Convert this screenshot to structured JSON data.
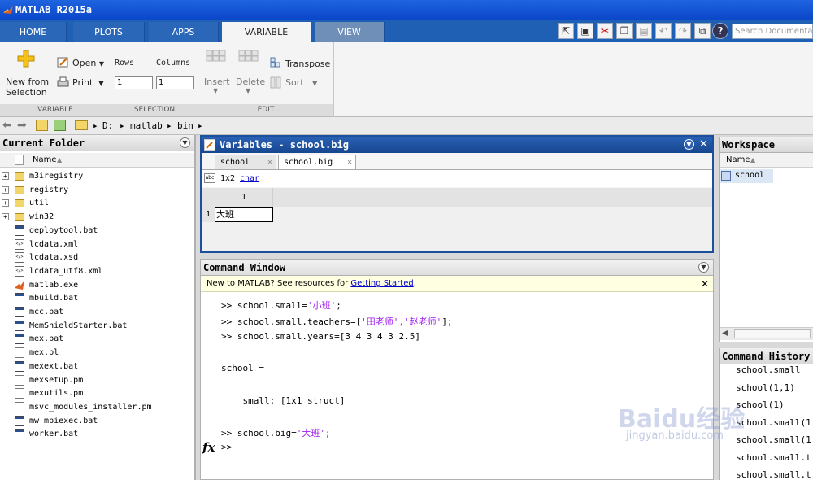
{
  "app": {
    "title": "MATLAB R2015a"
  },
  "ribbon_tabs": [
    {
      "label": "HOME"
    },
    {
      "label": "PLOTS"
    },
    {
      "label": "APPS"
    },
    {
      "label": "VARIABLE"
    },
    {
      "label": "VIEW"
    }
  ],
  "search": {
    "placeholder": "Search Documentation"
  },
  "ribbon": {
    "variable": {
      "new_from_line1": "New from",
      "new_from_line2": "Selection",
      "open": "Open",
      "print": "Print",
      "section": "VARIABLE"
    },
    "selection": {
      "rows_label": "Rows",
      "columns_label": "Columns",
      "rows_value": "1",
      "columns_value": "1",
      "section": "SELECTION"
    },
    "edit": {
      "insert": "Insert",
      "delete": "Delete",
      "transpose": "Transpose",
      "sort": "Sort",
      "section": "EDIT"
    }
  },
  "address": {
    "path": [
      "D:",
      "matlab",
      "bin"
    ]
  },
  "current_folder": {
    "title": "Current Folder",
    "column_name": "Name",
    "items": [
      {
        "name": "m3iregistry",
        "type": "folder"
      },
      {
        "name": "registry",
        "type": "folder"
      },
      {
        "name": "util",
        "type": "folder"
      },
      {
        "name": "win32",
        "type": "folder"
      },
      {
        "name": "deploytool.bat",
        "type": "bat"
      },
      {
        "name": "lcdata.xml",
        "type": "xml"
      },
      {
        "name": "lcdata.xsd",
        "type": "xml"
      },
      {
        "name": "lcdata_utf8.xml",
        "type": "xml"
      },
      {
        "name": "matlab.exe",
        "type": "exe"
      },
      {
        "name": "mbuild.bat",
        "type": "bat"
      },
      {
        "name": "mcc.bat",
        "type": "bat"
      },
      {
        "name": "MemShieldStarter.bat",
        "type": "bat"
      },
      {
        "name": "mex.bat",
        "type": "bat"
      },
      {
        "name": "mex.pl",
        "type": "txt"
      },
      {
        "name": "mexext.bat",
        "type": "bat"
      },
      {
        "name": "mexsetup.pm",
        "type": "txt"
      },
      {
        "name": "mexutils.pm",
        "type": "txt"
      },
      {
        "name": "msvc_modules_installer.pm",
        "type": "txt"
      },
      {
        "name": "mw_mpiexec.bat",
        "type": "bat"
      },
      {
        "name": "worker.bat",
        "type": "bat"
      }
    ]
  },
  "variables": {
    "title": "Variables - school.big",
    "tabs": [
      {
        "label": "school"
      },
      {
        "label": "school.big"
      }
    ],
    "size": "1x2",
    "class": "char",
    "col_header": "1",
    "row_header": "1",
    "cell": "大班"
  },
  "command_window": {
    "title": "Command Window",
    "banner_prefix": "New to MATLAB? See resources for ",
    "banner_link": "Getting Started",
    "banner_suffix": ".",
    "lines": [
      {
        "pre": ">> school.small=",
        "str": "'小班'",
        "post": ";"
      },
      {
        "pre": ">> school.small.teachers=[",
        "str": "'田老师','赵老师'",
        "post": "];"
      },
      {
        "pre": ">> school.small.years=[3 4 3 4 3 2.5]",
        "str": "",
        "post": ""
      },
      {
        "pre": "school =",
        "str": "",
        "post": ""
      },
      {
        "pre": "    small: [1x1 struct]",
        "str": "",
        "post": ""
      },
      {
        "pre": ">> school.big=",
        "str": "'大班'",
        "post": ";"
      },
      {
        "pre": ">>",
        "str": "",
        "post": ""
      }
    ],
    "fx": "fx"
  },
  "workspace": {
    "title": "Workspace",
    "column_name": "Name",
    "items": [
      {
        "name": "school"
      }
    ]
  },
  "history": {
    "title": "Command History",
    "items": [
      "school.small",
      "school(1,1)",
      "school(1)",
      "school.small(1",
      "school.small(1",
      "school.small.t",
      "school.small.t"
    ]
  },
  "watermark": {
    "text": "Baidu经验",
    "sub": "jingyan.baidu.com"
  },
  "colors": {
    "title_bar": "#0a46c8",
    "ribbon_tab_bar": "#1f5fb4",
    "string": "#a020f0",
    "link": "#0000cc"
  }
}
